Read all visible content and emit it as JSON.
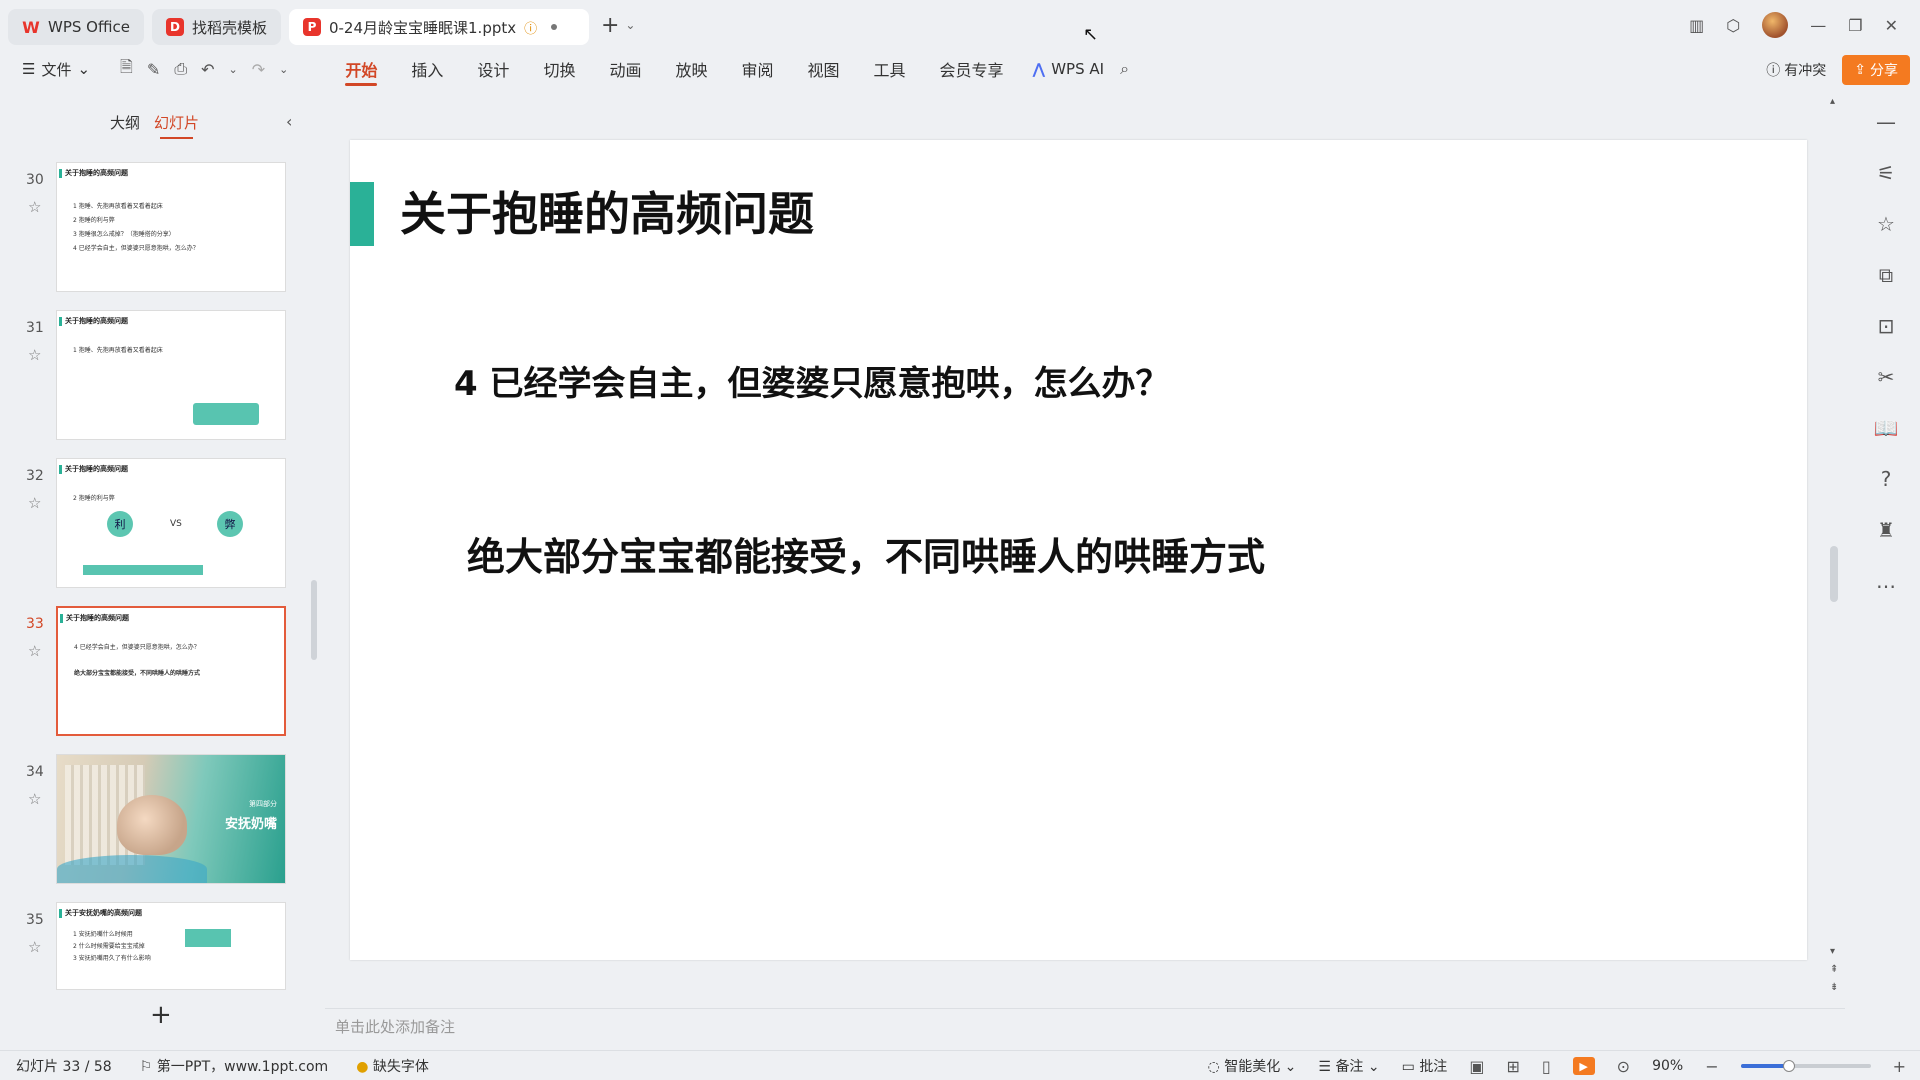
{
  "tabs": [
    {
      "label": "WPS Office",
      "icon": "wps-logo-icon"
    },
    {
      "label": "找稻壳模板",
      "icon": "docer-logo-icon"
    },
    {
      "label": "0-24月龄宝宝睡眠课1.pptx",
      "icon": "ppt-file-icon"
    }
  ],
  "ribbon": {
    "file_label": "文件",
    "menu": [
      "开始",
      "插入",
      "设计",
      "切换",
      "动画",
      "放映",
      "审阅",
      "视图",
      "工具",
      "会员专享"
    ],
    "active_menu": "开始",
    "ai_label": "WPS AI",
    "conflict_label": "有冲突",
    "share_label": "分享"
  },
  "left_panel": {
    "tabs": [
      "大纲",
      "幻灯片"
    ],
    "active_tab": "幻灯片",
    "thumbnails": [
      {
        "num": "30",
        "title": "关于抱睡的高频问题",
        "lines": [
          "1 抱睡、先抱再放看着又看着起床",
          "2 抱睡的利与弊",
          "3 抱睡很怎么戒掉？（抱睡搭的分享）",
          "4 已经学会自主，但婆婆只愿意抱哄，怎么办？"
        ]
      },
      {
        "num": "31",
        "title": "关于抱睡的高频问题",
        "lines": [
          "1 抱睡、先抱再放看着又看着起床"
        ]
      },
      {
        "num": "32",
        "title": "关于抱睡的高频问题",
        "lines": [
          "2 抱睡的利与弊"
        ],
        "left_circle": "利",
        "vs": "VS",
        "right_circle": "弊"
      },
      {
        "num": "33",
        "title": "关于抱睡的高频问题",
        "lines": [
          "4 已经学会自主，但婆婆只愿意抱哄，怎么办？",
          "绝大部分宝宝都能接受，不同哄睡人的哄睡方式"
        ]
      },
      {
        "num": "34",
        "photo_small": "第四部分",
        "photo_big": "安抚奶嘴"
      },
      {
        "num": "35",
        "title": "关于安抚奶嘴的高频问题",
        "lines": [
          "1 安抚奶嘴什么时候用",
          "2 什么时候需要给宝宝戒掉",
          "3 安抚奶嘴用久了有什么影响"
        ]
      }
    ],
    "active_slide": "33"
  },
  "slide": {
    "title": "关于抱睡的高频问题",
    "question": "4 已经学会自主，但婆婆只愿意抱哄，怎么办？",
    "answer": "绝大部分宝宝都能接受，不同哄睡人的哄睡方式",
    "accent_color": "#2ab197"
  },
  "notes_placeholder": "单击此处添加备注",
  "status": {
    "slide_counter": "幻灯片 33 / 58",
    "template": "第一PPT，www.1ppt.com",
    "missing_font": "缺失字体",
    "beautify": "智能美化",
    "notes": "备注",
    "comments": "批注",
    "zoom": "90%",
    "zoom_level": 0.37
  },
  "colors": {
    "accent_orange": "#d24726",
    "share_orange": "#f47a20",
    "teal": "#2ab197"
  }
}
